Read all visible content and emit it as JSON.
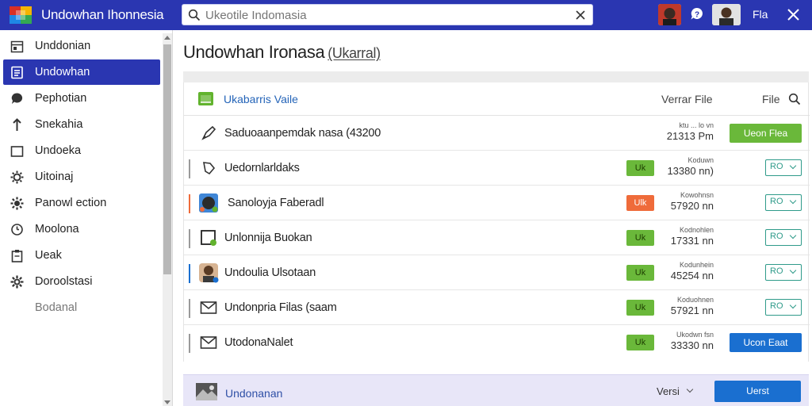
{
  "colors": {
    "brand": "#2a36b1",
    "accent_blue": "#1a6fd0",
    "ok_green": "#62b32e",
    "warn_orange": "#ef6b3a",
    "teal": "#2f9b8a"
  },
  "header": {
    "app_title": "Undowhan Ihonnesia",
    "search_placeholder": "Ukeotile Indomasia",
    "file_label": "Fla",
    "logo_icon": "app-logo-icon",
    "help_icon": "help-chat-icon",
    "close_icon": "close-icon"
  },
  "sidebar": {
    "items": [
      {
        "label": "Unddonian",
        "icon": "calendar-icon"
      },
      {
        "label": "Undowhan",
        "icon": "document-icon",
        "active": true
      },
      {
        "label": "Pephotian",
        "icon": "chat-bubble-icon"
      },
      {
        "label": "Snekahia",
        "icon": "pin-icon"
      },
      {
        "label": "Undoeka",
        "icon": "folder-icon"
      },
      {
        "label": "Uitoinaj",
        "icon": "gear-icon"
      },
      {
        "label": "Panowl ection",
        "icon": "settings-icon"
      },
      {
        "label": "Moolona",
        "icon": "clock-icon"
      },
      {
        "label": "Ueak",
        "icon": "clipboard-icon"
      },
      {
        "label": "Doroolstasi",
        "icon": "cog-icon"
      },
      {
        "label": "Bodanal",
        "icon": "none",
        "muted": true
      }
    ]
  },
  "main": {
    "title": "Undowhan Ironasa",
    "title_sub": "(Ukarral)",
    "column_header": {
      "title": "Ukabarris Vaile",
      "version": "Verrar File",
      "file": "File"
    },
    "rows": [
      {
        "name": "Saduoaanpemdak nasa (43200",
        "icon": "rocket-icon",
        "badge": "",
        "meta_top": "ktu ... lo vn",
        "meta_bottom": "21313 Pm",
        "action": "Ueon Flea",
        "action_type": "button-green"
      },
      {
        "name": "Uedornlarldaks",
        "icon": "shield-icon",
        "badge": "Uk",
        "badge_color": "#62b32e",
        "meta_top": "Koduwn",
        "meta_bottom": "13380 nn)",
        "action": "RO",
        "action_type": "select"
      },
      {
        "name": "Sanoloyja Faberadl",
        "icon": "app-thumbnail-icon",
        "badge": "Ulk",
        "badge_color": "#ef6b3a",
        "meta_top": "Kowohnsn",
        "meta_bottom": "57920 nn",
        "action": "RO",
        "action_type": "select"
      },
      {
        "name": "Unlonnija Buokan",
        "icon": "frame-icon",
        "badge": "Uk",
        "badge_color": "#62b32e",
        "meta_top": "Kodnohlen",
        "meta_bottom": "17331 nn",
        "action": "RO",
        "action_type": "select"
      },
      {
        "name": "Undoulia Ulsotaan",
        "icon": "avatar-icon",
        "badge": "Uk",
        "badge_color": "#62b32e",
        "meta_top": "Kodunhein",
        "meta_bottom": "45254 nn",
        "action": "RO",
        "action_type": "select"
      },
      {
        "name": "Undonpria Filas (saam",
        "icon": "mail-icon",
        "badge": "Uk",
        "badge_color": "#62b32e",
        "meta_top": "Koduohnen",
        "meta_bottom": "57921 nn",
        "action": "RO",
        "action_type": "select"
      },
      {
        "name": "UtodonaNalet",
        "icon": "mail-icon",
        "badge": "Uk",
        "badge_color": "#62b32e",
        "meta_top": "Ukodwn fsn",
        "meta_bottom": "33330 nn",
        "action": "Ucon Eaat",
        "action_type": "button-blue"
      }
    ]
  },
  "footer": {
    "name": "Undonanan",
    "version_label": "Versi",
    "button": "Uerst"
  }
}
